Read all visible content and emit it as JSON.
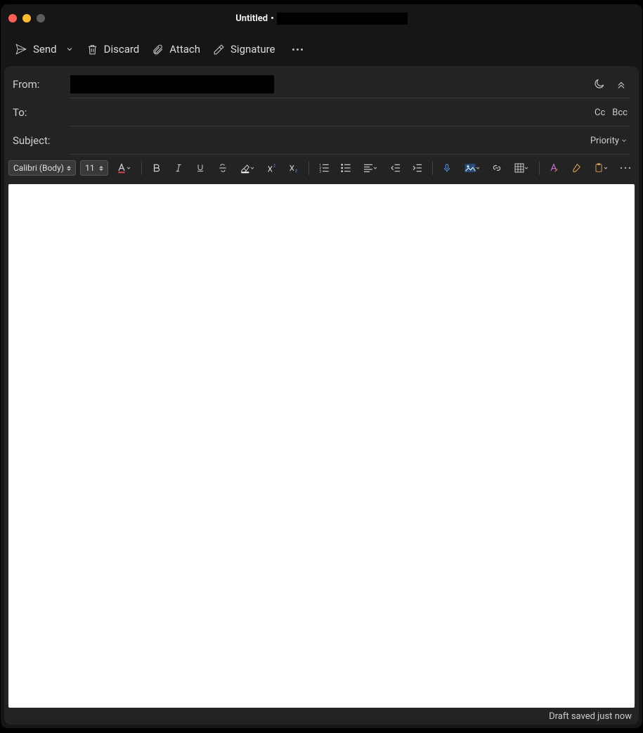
{
  "window": {
    "title_main": "Untitled",
    "title_sep": "•"
  },
  "actions": {
    "send": "Send",
    "discard": "Discard",
    "attach": "Attach",
    "signature": "Signature"
  },
  "fields": {
    "from_label": "From:",
    "to_label": "To:",
    "subject_label": "Subject:",
    "cc": "Cc",
    "bcc": "Bcc",
    "priority_label": "Priority"
  },
  "format": {
    "font": "Calibri (Body)",
    "size": "11"
  },
  "status": {
    "draft_saved": "Draft saved just now"
  }
}
